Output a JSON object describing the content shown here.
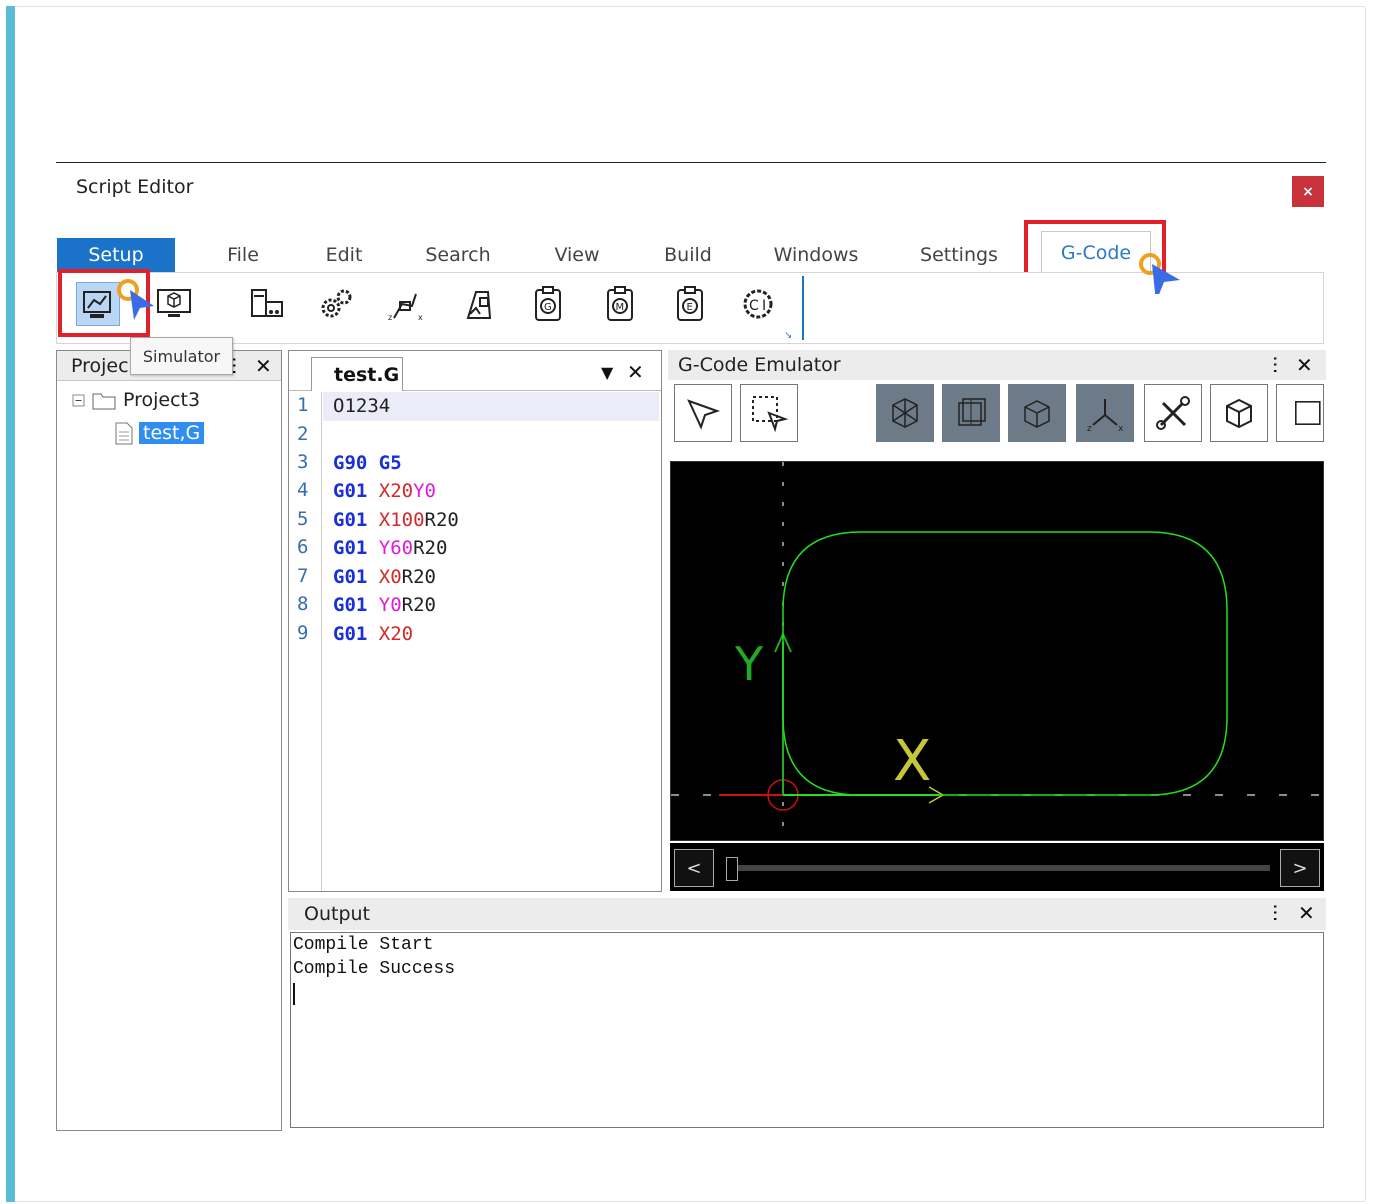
{
  "window": {
    "title": "Script Editor",
    "close_label": "×"
  },
  "menu": {
    "setup": "Setup",
    "file": "File",
    "edit": "Edit",
    "search": "Search",
    "view": "View",
    "build": "Build",
    "windows": "Windows",
    "settings": "Settings",
    "gcode": "G-Code"
  },
  "ribbon": {
    "tools": [
      "simulator-icon",
      "monitor-cube-icon",
      "panel-io-icon",
      "gears-icon",
      "axis-arm-icon",
      "machine-tool-icon",
      "g-code-clipboard-icon",
      "m-code-clipboard-icon",
      "e-code-clipboard-icon",
      "code-settings-icon"
    ],
    "tooltip": "Simulator"
  },
  "project": {
    "title": "Projec",
    "root": "Project3",
    "file": "test,G"
  },
  "editor": {
    "tab": "test.G",
    "lines": [
      "1",
      "2",
      "3",
      "4",
      "5",
      "6",
      "7",
      "8",
      "9"
    ],
    "code": {
      "l1": "O1234",
      "l3a": "G90",
      "l3b": "G5",
      "l4a": "G01",
      "l4b": "X20",
      "l4c": "Y0",
      "l5a": "G01",
      "l5b": "X100",
      "l5c": "R20",
      "l6a": "G01",
      "l6b": "Y60",
      "l6c": "R20",
      "l7a": "G01",
      "l7b": "X0",
      "l7c": "R20",
      "l8a": "G01",
      "l8b": "Y0",
      "l8c": "R20",
      "l9a": "G01",
      "l9b": "X20"
    }
  },
  "emulator": {
    "title": "G-Code Emulator",
    "axis_x": "X",
    "axis_y": "Y"
  },
  "output": {
    "title": "Output",
    "lines": [
      "Compile Start",
      "Compile Success"
    ]
  },
  "colors": {
    "accent": "#1a73c8",
    "highlight": "#e1202a",
    "path": "#22dd22"
  }
}
